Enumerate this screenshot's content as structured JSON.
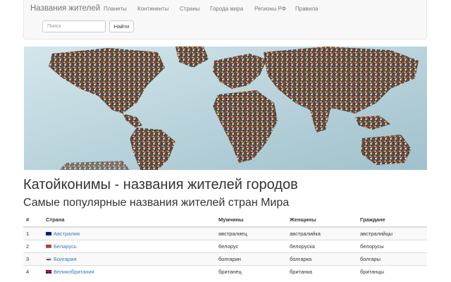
{
  "navbar": {
    "brand": "Названия жителей",
    "items": [
      "Планеты",
      "Континенты",
      "Страны",
      "Города мира",
      "Регионы РФ",
      "Правила"
    ],
    "search_placeholder": "Поиск",
    "search_button": "Найти"
  },
  "hero": {
    "image": "world-map-of-people-crowds"
  },
  "main": {
    "title": "Катойконимы - названия жителей городов",
    "subtitle": "Самые популярные названия жителей стран Мира"
  },
  "table": {
    "headers": [
      "#",
      "Страна",
      "Мужчины",
      "Женщины",
      "Граждане"
    ],
    "rows": [
      {
        "num": "1",
        "flag": "australia-flag-icon",
        "country": "Австралия",
        "male": "австралиец",
        "female": "австралийка",
        "citizens": "австралийцы"
      },
      {
        "num": "2",
        "flag": "belarus-flag-icon",
        "country": "Беларусь",
        "male": "белорус",
        "female": "белоруска",
        "citizens": "белорусы"
      },
      {
        "num": "3",
        "flag": "bulgaria-flag-icon",
        "country": "Болгария",
        "male": "болгарин",
        "female": "болгарка",
        "citizens": "болгары"
      },
      {
        "num": "4",
        "flag": "uk-flag-icon",
        "country": "Великобритания",
        "male": "британец",
        "female": "британка",
        "citizens": "британцы"
      }
    ]
  },
  "colors": {
    "link": "#337ab7",
    "navbar_bg": "#f8f8f8",
    "hero_sky": "#c6dde5"
  }
}
